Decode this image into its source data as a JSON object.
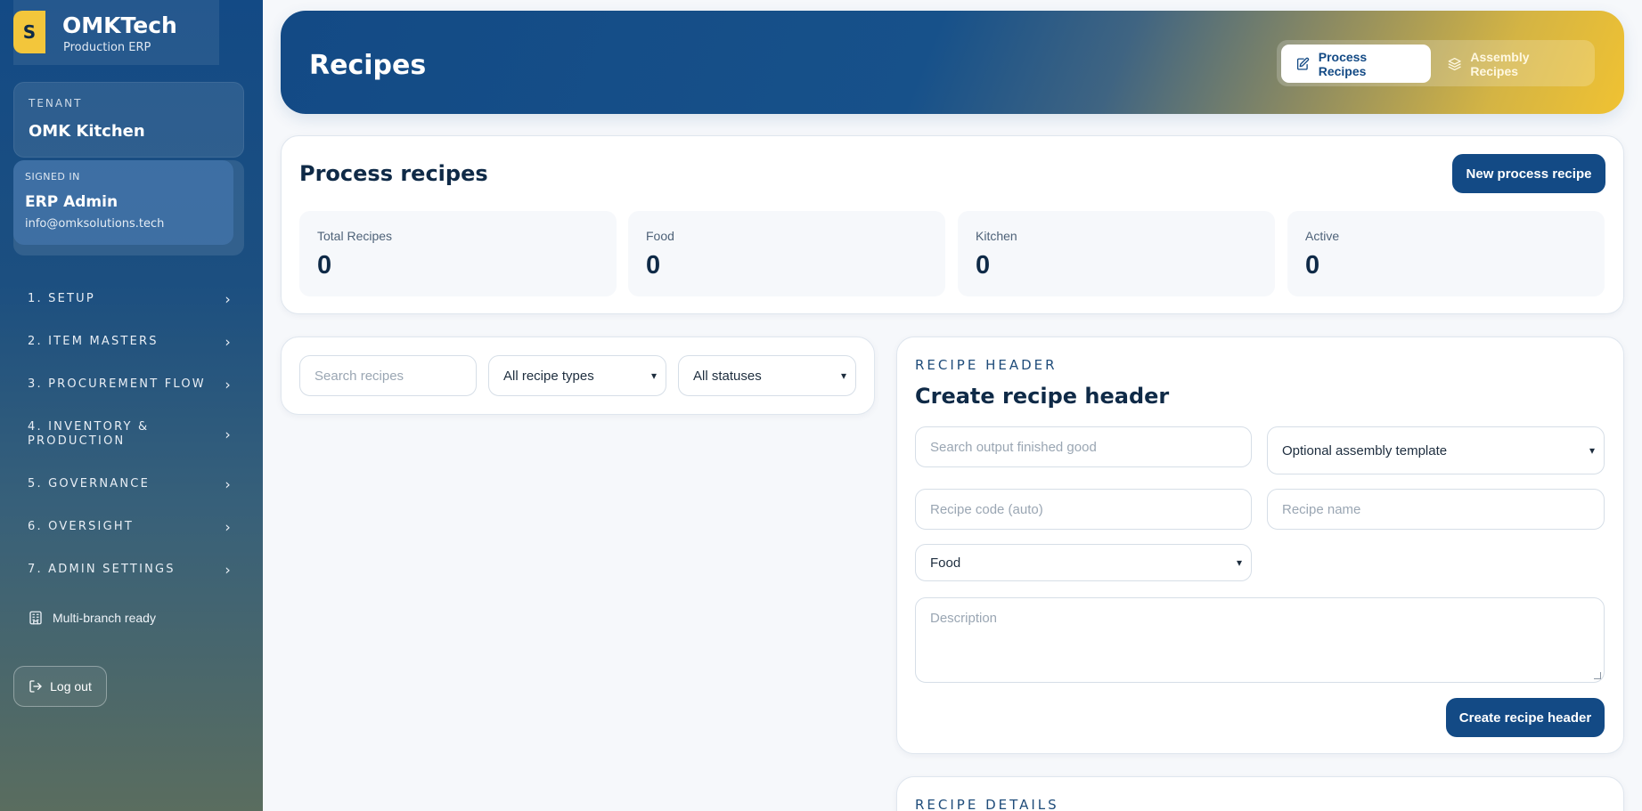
{
  "brand": {
    "logo_letter": "S",
    "name": "OMKTech",
    "subtitle": "Production ERP"
  },
  "tenant": {
    "label": "TENANT",
    "name": "OMK Kitchen"
  },
  "user": {
    "label": "SIGNED IN",
    "name": "ERP Admin",
    "email": "info@omksolutions.tech"
  },
  "nav": [
    {
      "label": "1. SETUP"
    },
    {
      "label": "2. ITEM MASTERS"
    },
    {
      "label": "3. PROCUREMENT FLOW"
    },
    {
      "label": "4. INVENTORY & PRODUCTION"
    },
    {
      "label": "5. GOVERNANCE"
    },
    {
      "label": "6. OVERSIGHT"
    },
    {
      "label": "7. ADMIN SETTINGS"
    }
  ],
  "sidebar_footer": {
    "multi_branch": "Multi-branch ready",
    "logout": "Log out"
  },
  "hero": {
    "title": "Recipes",
    "tabs": [
      {
        "label": "Process Recipes",
        "active": true,
        "icon": "edit-document-icon"
      },
      {
        "label": "Assembly Recipes",
        "active": false,
        "icon": "layers-icon"
      }
    ]
  },
  "summary": {
    "title": "Process recipes",
    "new_button": "New process recipe",
    "stats": [
      {
        "label": "Total Recipes",
        "value": "0"
      },
      {
        "label": "Food",
        "value": "0"
      },
      {
        "label": "Kitchen",
        "value": "0"
      },
      {
        "label": "Active",
        "value": "0"
      }
    ]
  },
  "filters": {
    "search_placeholder": "Search recipes",
    "type_selected": "All recipe types",
    "status_selected": "All statuses"
  },
  "recipe_header": {
    "eyebrow": "RECIPE HEADER",
    "title": "Create recipe header",
    "output_placeholder": "Search output finished good",
    "template_selected": "Optional assembly template",
    "code_placeholder": "Recipe code (auto)",
    "name_placeholder": "Recipe name",
    "type_selected": "Food",
    "description_placeholder": "Description",
    "submit": "Create recipe header"
  },
  "recipe_details": {
    "eyebrow": "RECIPE DETAILS"
  },
  "colors": {
    "primary": "#134a85",
    "accent": "#f0c232",
    "background": "#f6f8fb"
  }
}
